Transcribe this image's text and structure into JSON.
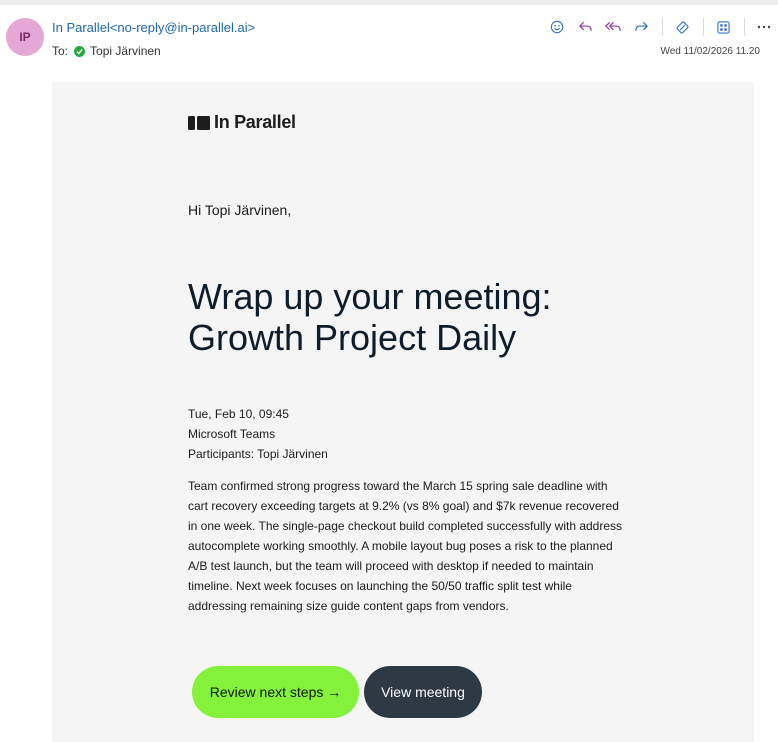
{
  "header": {
    "avatar_initials": "IP",
    "sender": "In Parallel<no-reply@in-parallel.ai>",
    "to_label": "To:",
    "recipient": "Topi Järvinen",
    "date": "Wed 11/02/2026 11.20",
    "actions": [
      "smiley-icon",
      "reply-icon",
      "reply-all-icon",
      "forward-icon",
      "eraser-icon",
      "apps-icon",
      "more-icon"
    ]
  },
  "email": {
    "logo_text": "In Parallel",
    "greeting": "Hi Topi Järvinen,",
    "title": "Wrap up your meeting: Growth Project Daily",
    "meta": {
      "datetime": "Tue, Feb 10, 09:45",
      "platform": "Microsoft Teams",
      "participants": "Participants: Topi Järvinen"
    },
    "summary": "Team confirmed strong progress toward the March 15 spring sale deadline with cart recovery exceeding targets at 9.2% (vs 8% goal) and $7k revenue recovered in one week. The single-page checkout build completed successfully with address autocomplete working smoothly. A mobile layout bug poses a risk to the planned A/B test launch, but the team will proceed with desktop if needed to maintain timeline. Next week focuses on launching the 50/50 traffic split test while addressing remaining size guide content gaps from vendors.",
    "primary_button": "Review next steps →",
    "secondary_button": "View meeting"
  },
  "colors": {
    "sender_link": "#1f67b1",
    "avatar_bg": "#e5a7d6",
    "primary_button_bg": "#84f23a",
    "secondary_button_bg": "#2d3a44",
    "card_bg": "#f5f5f5"
  }
}
